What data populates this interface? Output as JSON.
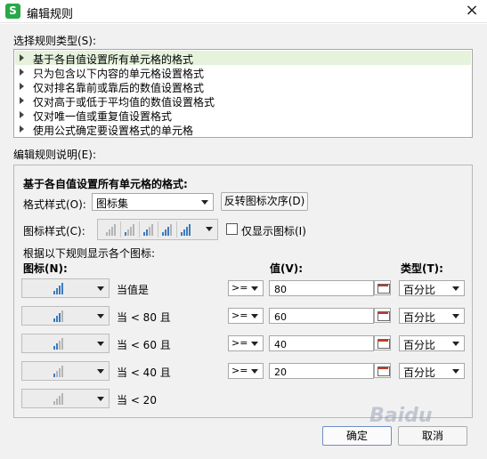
{
  "window": {
    "app_icon": "S",
    "title": "编辑规则",
    "close_glyph": "×"
  },
  "rule_type": {
    "label": "选择规则类型(S):",
    "items": [
      "基于各自值设置所有单元格的格式",
      "只为包含以下内容的单元格设置格式",
      "仅对排名靠前或靠后的数值设置格式",
      "仅对高于或低于平均值的数值设置格式",
      "仅对唯一值或重复值设置格式",
      "使用公式确定要设置格式的单元格"
    ],
    "selected_index": 0
  },
  "rule_desc": {
    "label": "编辑规则说明(E):",
    "heading": "基于各自值设置所有单元格的格式:",
    "format_style_label": "格式样式(O):",
    "format_style_value": "图标集",
    "reverse_button": "反转图标次序(D)",
    "icon_style_label": "图标样式(C):",
    "show_icon_only_label": "仅显示图标(I)",
    "show_icon_only_checked": false,
    "rules_intro": "根据以下规则显示各个图标:",
    "col_icon": "图标(N):",
    "col_value": "值(V):",
    "col_type": "类型(T):",
    "rows": [
      {
        "icon_level": 4,
        "desc": "当值是",
        "op": ">=",
        "value": "80",
        "type": "百分比"
      },
      {
        "icon_level": 3,
        "desc": "当 < 80 且",
        "op": ">=",
        "value": "60",
        "type": "百分比"
      },
      {
        "icon_level": 2,
        "desc": "当 < 60 且",
        "op": ">=",
        "value": "40",
        "type": "百分比"
      },
      {
        "icon_level": 1,
        "desc": "当 < 40 且",
        "op": ">=",
        "value": "20",
        "type": "百分比"
      },
      {
        "icon_level": 0,
        "desc": "当 < 20"
      }
    ]
  },
  "buttons": {
    "ok": "确定",
    "cancel": "取消"
  },
  "watermark": "Baidu"
}
